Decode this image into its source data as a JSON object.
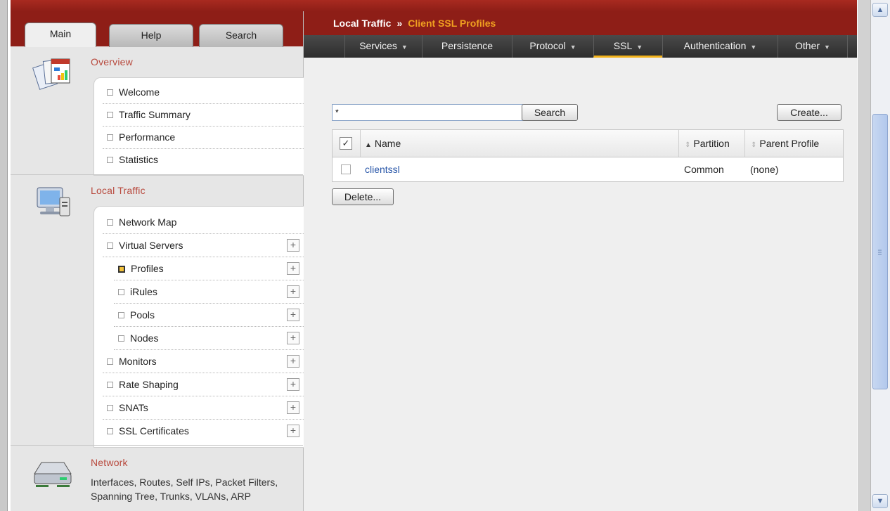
{
  "tabs": {
    "main": "Main",
    "help": "Help",
    "search": "Search"
  },
  "sections": {
    "overview": {
      "title": "Overview",
      "items": [
        "Welcome",
        "Traffic Summary",
        "Performance",
        "Statistics"
      ]
    },
    "local_traffic": {
      "title": "Local Traffic",
      "items": {
        "network_map": "Network Map",
        "virtual_servers": "Virtual Servers",
        "profiles": "Profiles",
        "irules": "iRules",
        "pools": "Pools",
        "nodes": "Nodes",
        "monitors": "Monitors",
        "rate_shaping": "Rate Shaping",
        "snats": "SNATs",
        "ssl_certificates": "SSL Certificates"
      },
      "plus": "+"
    },
    "network": {
      "title": "Network",
      "description": "Interfaces, Routes, Self IPs, Packet Filters, Spanning Tree, Trunks, VLANs, ARP"
    }
  },
  "breadcrumb": {
    "part1": "Local Traffic",
    "separator": "»",
    "part2": "Client SSL Profiles"
  },
  "menu": {
    "services": "Services",
    "persistence": "Persistence",
    "protocol": "Protocol",
    "ssl": "SSL",
    "authentication": "Authentication",
    "other": "Other",
    "caret": "▼"
  },
  "search": {
    "value": "*",
    "button": "Search"
  },
  "create_button": "Create...",
  "delete_button": "Delete...",
  "table": {
    "columns": {
      "name": "Name",
      "partition": "Partition",
      "parent_profile": "Parent Profile"
    },
    "rows": [
      {
        "name": "clientssl",
        "partition": "Common",
        "parent": "(none)"
      }
    ]
  },
  "icons": {
    "sort_asc": "▲",
    "sort_both": "⇕",
    "check": "✓",
    "scroll_up": "▲",
    "scroll_down": "▼"
  },
  "colors": {
    "header_red": "#8e1e17",
    "breadcrumb_highlight": "#f0a020",
    "section_title": "#b84a3e",
    "link_blue": "#2856a8",
    "menu_active_underline": "#f2b21b"
  }
}
